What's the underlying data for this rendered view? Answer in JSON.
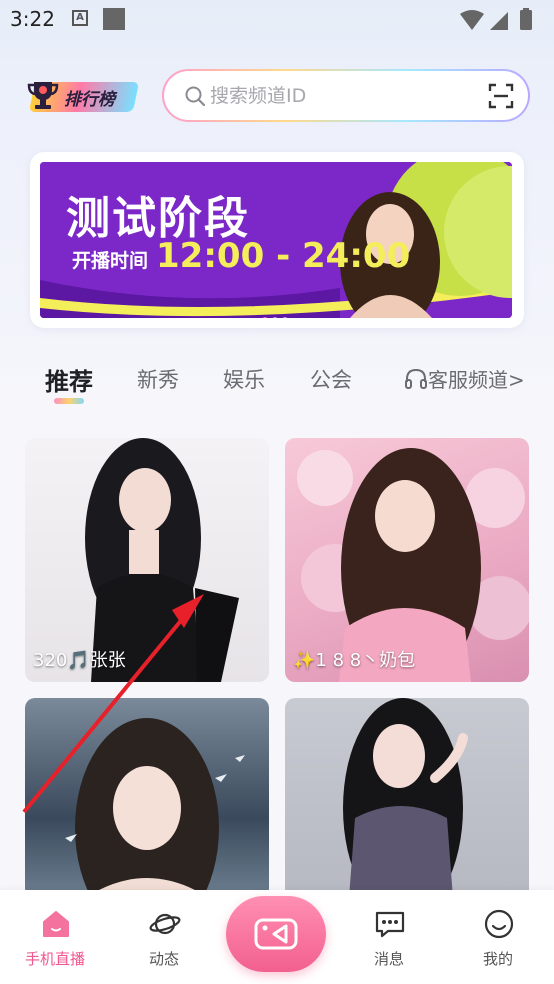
{
  "status_bar": {
    "time": "3:22",
    "notif_letter": "A"
  },
  "header": {
    "rank_label": "排行榜",
    "search_placeholder": "搜索频道ID"
  },
  "banner": {
    "title": "测试阶段",
    "time_label": "开播时间",
    "time_range": "12:00 - 24:00",
    "dot_count": 3,
    "active_dot": 0
  },
  "tabs": [
    {
      "label": "推荐",
      "active": true
    },
    {
      "label": "新秀",
      "active": false
    },
    {
      "label": "娱乐",
      "active": false
    },
    {
      "label": "公会",
      "active": false
    }
  ],
  "customer_service_tab": {
    "label": "客服频道>",
    "icon": "headset-icon"
  },
  "cards": [
    {
      "label": "320🎵张张"
    },
    {
      "label": "✨1 8 8丶奶包"
    },
    {
      "label": ""
    },
    {
      "label": ""
    }
  ],
  "bottom_nav": {
    "live_label": "手机直播",
    "moments_label": "动态",
    "messages_label": "消息",
    "me_label": "我的"
  },
  "colors": {
    "accent_pink": "#f0568f",
    "banner_purple": "#7c28c8",
    "banner_yellow": "#f4ee5a",
    "annotation_arrow": "#e8202a"
  }
}
